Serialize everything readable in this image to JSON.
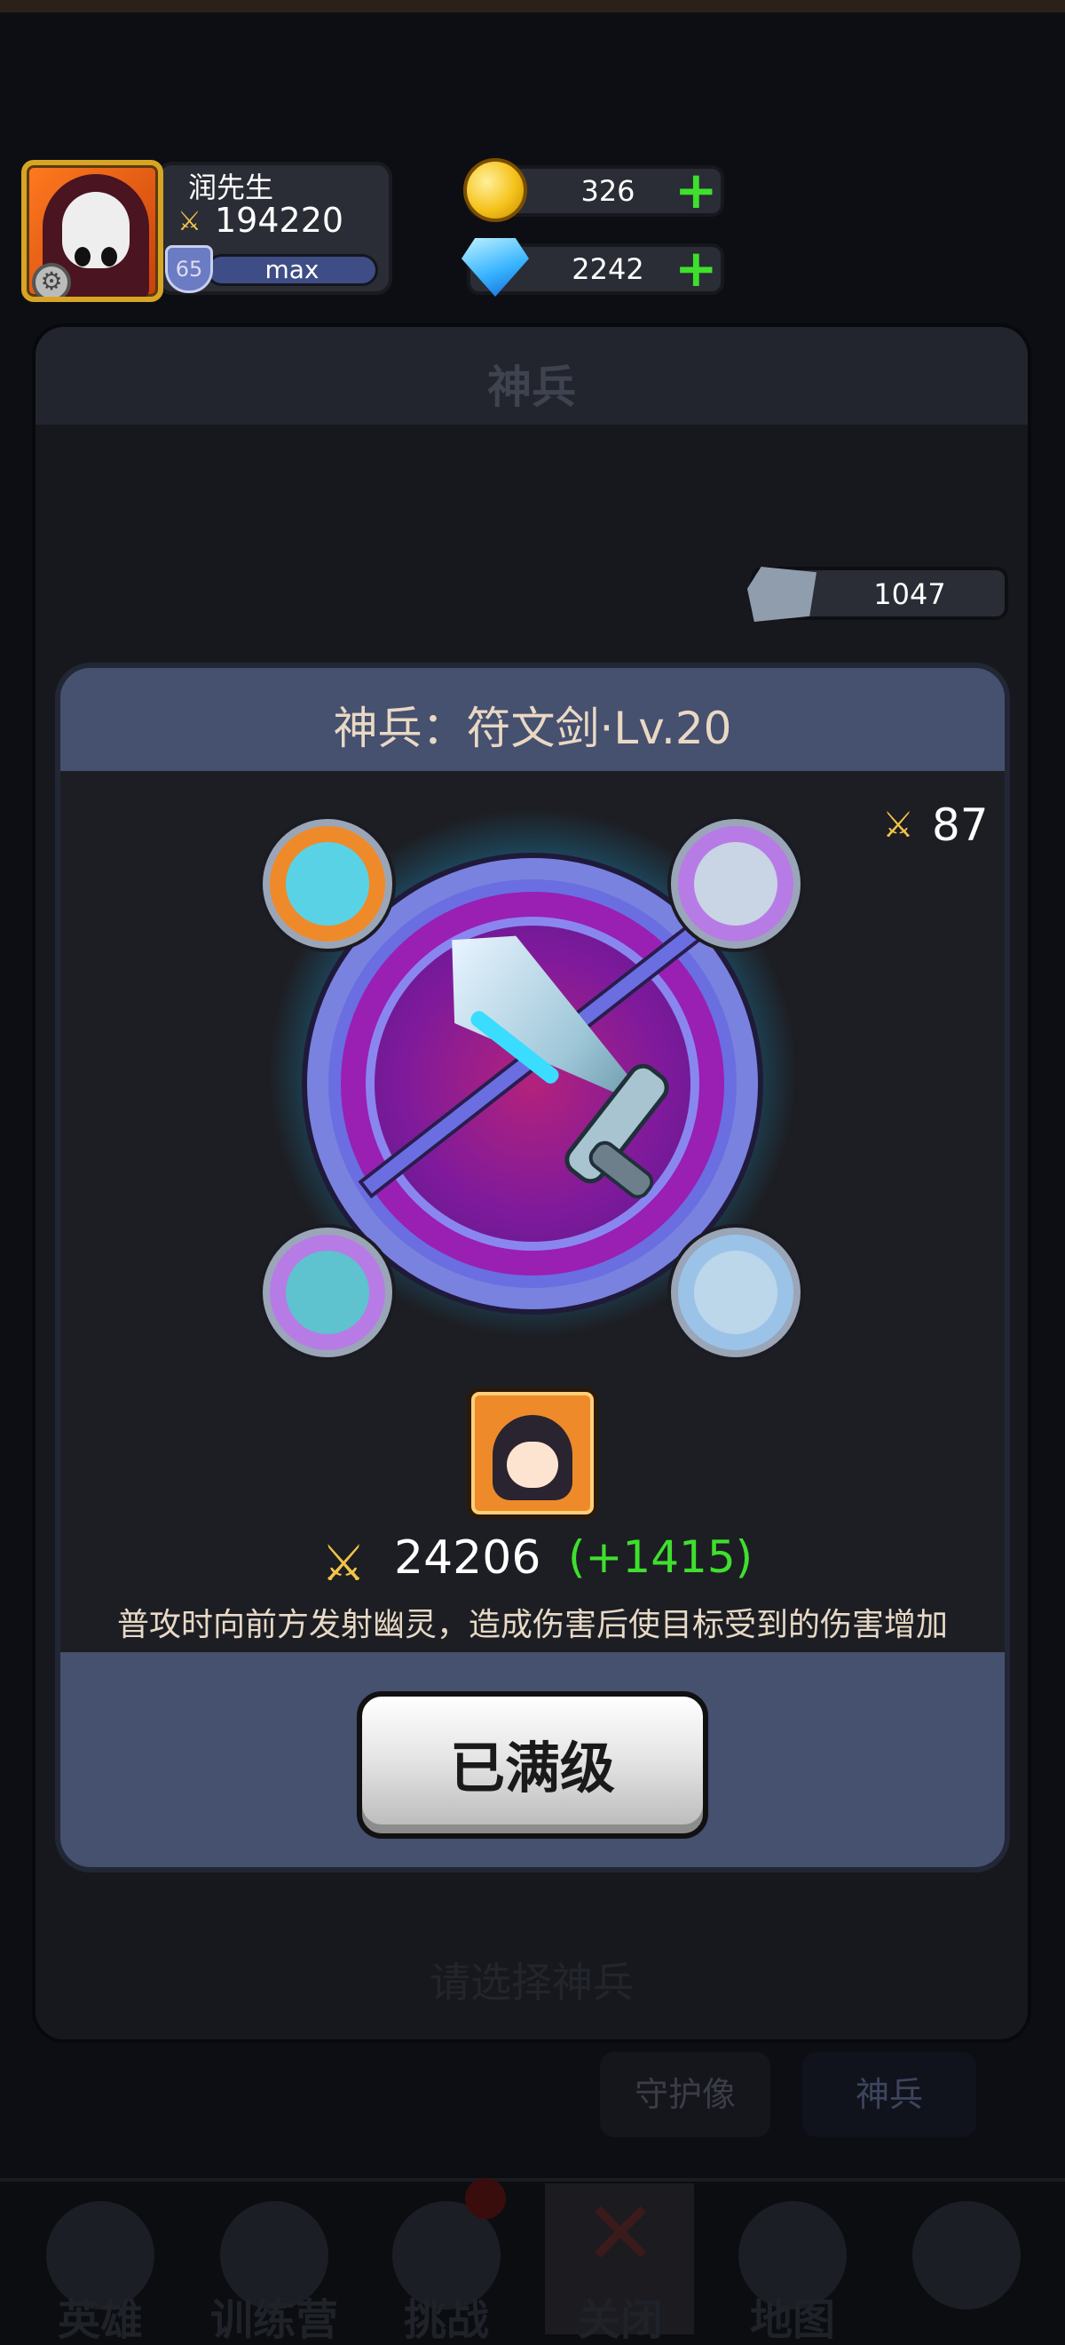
{
  "player": {
    "name": "润先生",
    "power": "194220",
    "level": "65",
    "exp_text": "max"
  },
  "currencies": {
    "gold": "326",
    "diamond": "2242",
    "rune_stone": "1047"
  },
  "background_panel": {
    "title": "神兵",
    "select_hint": "请选择神兵"
  },
  "sub_tabs": [
    "守护像",
    "神兵"
  ],
  "modal": {
    "title": "神兵：符文剑·Lv.20",
    "weapon_power": "87",
    "total_power": "24206",
    "power_gain": "(+1415)",
    "skill_description": "普攻时向前方发射幽灵，造成伤害后使目标受到的伤害增加",
    "max_button_label": "已满级"
  },
  "bottom_nav": [
    {
      "label": "英雄",
      "icon": "hero-icon"
    },
    {
      "label": "训练营",
      "icon": "target-icon"
    },
    {
      "label": "挑战",
      "icon": "sword-shield-icon"
    },
    {
      "label": "关闭",
      "icon": "close-icon"
    },
    {
      "label": "地图",
      "icon": "map-icon"
    },
    {
      "label": "",
      "icon": "lock-icon"
    }
  ],
  "colors": {
    "accent_green": "#3ee02d",
    "modal_header": "#46506f",
    "gold": "#f5c21b"
  }
}
